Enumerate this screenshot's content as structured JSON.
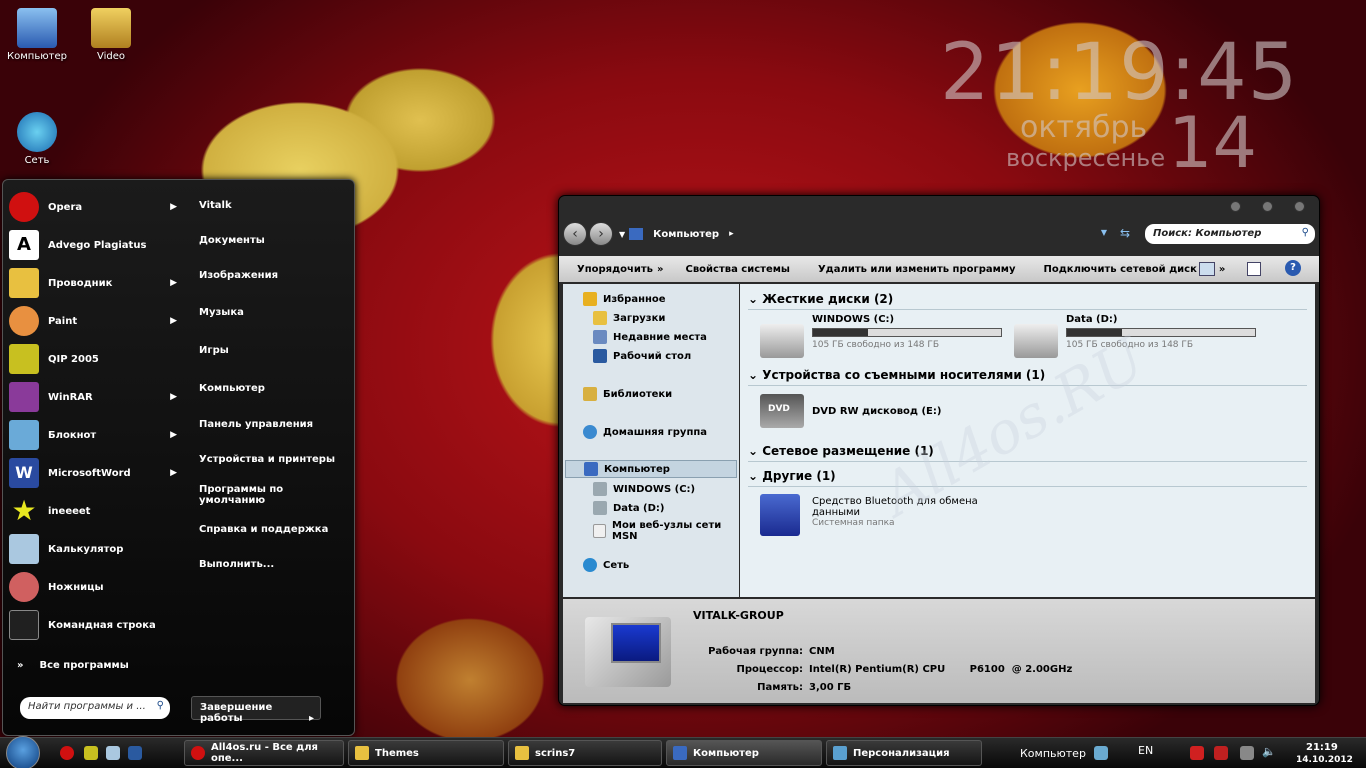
{
  "desktop": {
    "icons": [
      {
        "label": "Компьютер",
        "color": "#3a7ad0"
      },
      {
        "label": "Video",
        "color": "#d8b040"
      },
      {
        "label": "Сеть",
        "color": "#2a8ad0"
      }
    ]
  },
  "clock": {
    "time": "21:19:45",
    "month": "октябрь",
    "weekday": "воскресенье",
    "day": "14"
  },
  "watermark": "All4os.RU",
  "start_menu": {
    "programs": [
      {
        "label": "Opera",
        "icon": "opera-icon",
        "color": "#d01010",
        "arrow": true
      },
      {
        "label": "Advego Plagiatus",
        "icon": "advego-icon",
        "color": "#ffffff",
        "arrow": false
      },
      {
        "label": "Проводник",
        "icon": "folder-icon",
        "color": "#e8c040",
        "arrow": true
      },
      {
        "label": "Paint",
        "icon": "paint-icon",
        "color": "#e89040",
        "arrow": true
      },
      {
        "label": "QIP 2005",
        "icon": "qip-icon",
        "color": "#c8c020",
        "arrow": false
      },
      {
        "label": "WinRAR",
        "icon": "winrar-icon",
        "color": "#8a3a9a",
        "arrow": true
      },
      {
        "label": "Блокнот",
        "icon": "notepad-icon",
        "color": "#6aaad8",
        "arrow": true
      },
      {
        "label": "MicrosoftWord",
        "icon": "word-icon",
        "color": "#2a4aa0",
        "arrow": true
      },
      {
        "label": "ineeeet",
        "icon": "star-icon",
        "color": "#e8e820",
        "arrow": false
      },
      {
        "label": "Калькулятор",
        "icon": "calculator-icon",
        "color": "#aac8e0",
        "arrow": false
      },
      {
        "label": "Ножницы",
        "icon": "scissors-icon",
        "color": "#d06060",
        "arrow": false
      },
      {
        "label": "Командная строка",
        "icon": "cmd-icon",
        "color": "#202020",
        "arrow": false
      }
    ],
    "all_programs": "Все программы",
    "search_placeholder": "Найти программы и ...",
    "places": [
      "Vitalk",
      "Документы",
      "Изображения",
      "Музыка",
      "Игры",
      "Компьютер",
      "Панель управления",
      "Устройства и принтеры",
      "Программы по умолчанию",
      "Справка и поддержка",
      "Выполнить..."
    ],
    "shutdown": "Завершение работы"
  },
  "explorer": {
    "breadcrumb": "Компьютер",
    "search_placeholder": "Поиск: Компьютер",
    "toolbar": [
      "Упорядочить",
      "Свойства системы",
      "Удалить или изменить программу",
      "Подключить сетевой диск"
    ],
    "nav": [
      {
        "label": "Избранное",
        "color": "#e8b020",
        "indent": false
      },
      {
        "label": "Загрузки",
        "color": "#e8c040",
        "indent": true
      },
      {
        "label": "Недавние места",
        "color": "#6a8ac0",
        "indent": true
      },
      {
        "label": "Рабочий стол",
        "color": "#2a5aa0",
        "indent": true
      },
      {
        "label": "Библиотеки",
        "color": "#d8b040",
        "indent": false
      },
      {
        "label": "Домашняя группа",
        "color": "#3a8ad0",
        "indent": false
      },
      {
        "label": "Компьютер",
        "color": "#3a6ac0",
        "indent": false
      },
      {
        "label": "WINDOWS (C:)",
        "color": "#9aa8b0",
        "indent": true
      },
      {
        "label": "Data (D:)",
        "color": "#9aa8b0",
        "indent": true
      },
      {
        "label": "Мои веб-узлы сети MSN",
        "color": "#f0f0f0",
        "indent": true
      },
      {
        "label": "Сеть",
        "color": "#2a8ad0",
        "indent": false
      }
    ],
    "groups": [
      "Жесткие диски (2)",
      "Устройства со съемными носителями (1)",
      "Сетевое размещение (1)",
      "Другие (1)"
    ],
    "drives": [
      {
        "name": "WINDOWS (C:)",
        "free": "105 ГБ свободно из 148 ГБ",
        "used_fraction": 0.29
      },
      {
        "name": "Data (D:)",
        "free": "105 ГБ свободно из 148 ГБ",
        "used_fraction": 0.29
      }
    ],
    "dvd": "DVD RW дисковод (E:)",
    "dvd_label": "DVD",
    "bluetooth": {
      "name1": "Средство Bluetooth для обмена",
      "name2": "данными",
      "sub": "Системная папка"
    },
    "details": {
      "computer": "VITALK-GROUP",
      "workgroup_label": "Рабочая группа:",
      "workgroup": "CNM",
      "cpu_label": "Процессор:",
      "cpu": "Intel(R) Pentium(R) CPU       P6100  @ 2.00GHz",
      "ram_label": "Память:",
      "ram": "3,00 ГБ"
    }
  },
  "taskbar": {
    "buttons": [
      {
        "label": "All4os.ru - Все для опе...",
        "color": "#d01010"
      },
      {
        "label": "Themes",
        "color": "#e8c040"
      },
      {
        "label": "scrins7",
        "color": "#e8c040"
      },
      {
        "label": "Компьютер",
        "color": "#3a6ac0"
      },
      {
        "label": "Персонализация",
        "color": "#5aa0d0"
      }
    ],
    "toolbar_label": "Компьютер",
    "lang": "EN",
    "time": "21:19",
    "date": "14.10.2012"
  }
}
